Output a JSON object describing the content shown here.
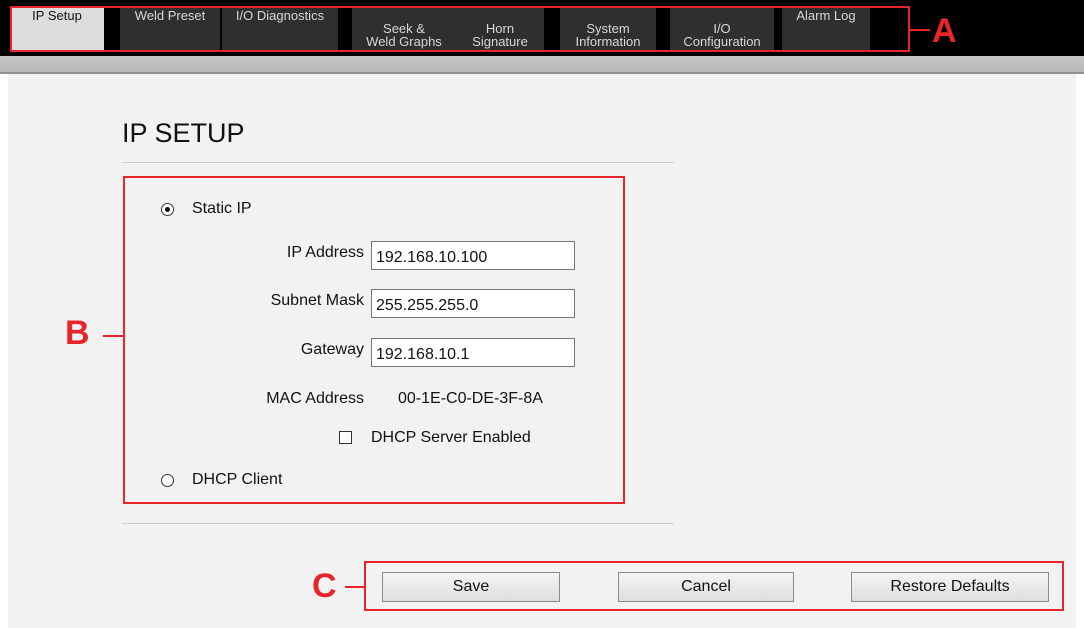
{
  "nav": {
    "tabs": [
      {
        "label": "IP Setup",
        "active": true
      },
      {
        "label": "Weld Preset"
      },
      {
        "label": "I/O Diagnostics"
      },
      {
        "label": "Seek &\nWeld Graphs"
      },
      {
        "label": "Horn\nSignature"
      },
      {
        "label": "System\nInformation"
      },
      {
        "label": "I/O\nConfiguration"
      },
      {
        "label": "Alarm Log"
      }
    ]
  },
  "page": {
    "title": "IP SETUP"
  },
  "network": {
    "static_ip_label": "Static IP",
    "static_selected": true,
    "ip_address_label": "IP Address",
    "ip_address_value": "192.168.10.100",
    "subnet_mask_label": "Subnet Mask",
    "subnet_mask_value": "255.255.255.0",
    "gateway_label": "Gateway",
    "gateway_value": "192.168.10.1",
    "mac_address_label": "MAC Address",
    "mac_address_value": "00-1E-C0-DE-3F-8A",
    "dhcp_server_label": "DHCP Server Enabled",
    "dhcp_server_checked": false,
    "dhcp_client_label": "DHCP Client"
  },
  "actions": {
    "save_label": "Save",
    "cancel_label": "Cancel",
    "restore_label": "Restore Defaults"
  },
  "callouts": {
    "a": "A",
    "b": "B",
    "c": "C"
  },
  "colors": {
    "callout": "#e8262a",
    "top_bar": "#000000",
    "content_bg": "#f2f2f2"
  }
}
